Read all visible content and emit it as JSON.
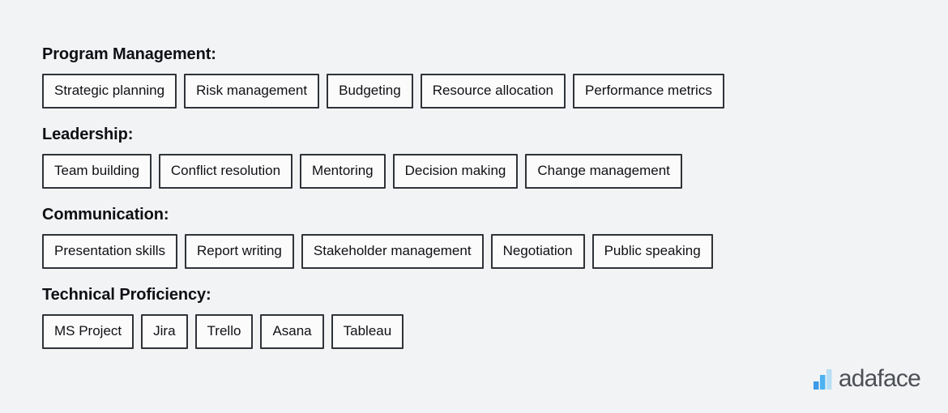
{
  "skills": {
    "groups": [
      {
        "heading": "Program Management:",
        "chips": [
          "Strategic planning",
          "Risk management",
          "Budgeting",
          "Resource allocation",
          "Performance metrics"
        ]
      },
      {
        "heading": "Leadership:",
        "chips": [
          "Team building",
          "Conflict resolution",
          "Mentoring",
          "Decision making",
          "Change management"
        ]
      },
      {
        "heading": "Communication:",
        "chips": [
          "Presentation skills",
          "Report writing",
          "Stakeholder management",
          "Negotiation",
          "Public speaking"
        ]
      },
      {
        "heading": "Technical Proficiency:",
        "chips": [
          "MS Project",
          "Jira",
          "Trello",
          "Asana",
          "Tableau"
        ]
      }
    ]
  },
  "brand": {
    "name": "adaface",
    "mark_icon": "bar-chart-icon",
    "mark_bar_colors": [
      "#3d9ae8",
      "#4db2f0",
      "#b9dff5"
    ]
  },
  "colors": {
    "background": "#f2f3f5",
    "chip_border": "#2f3338",
    "chip_fill": "#fbfbfc",
    "heading_text": "#101014",
    "wordmark_text": "#4c4f55"
  }
}
